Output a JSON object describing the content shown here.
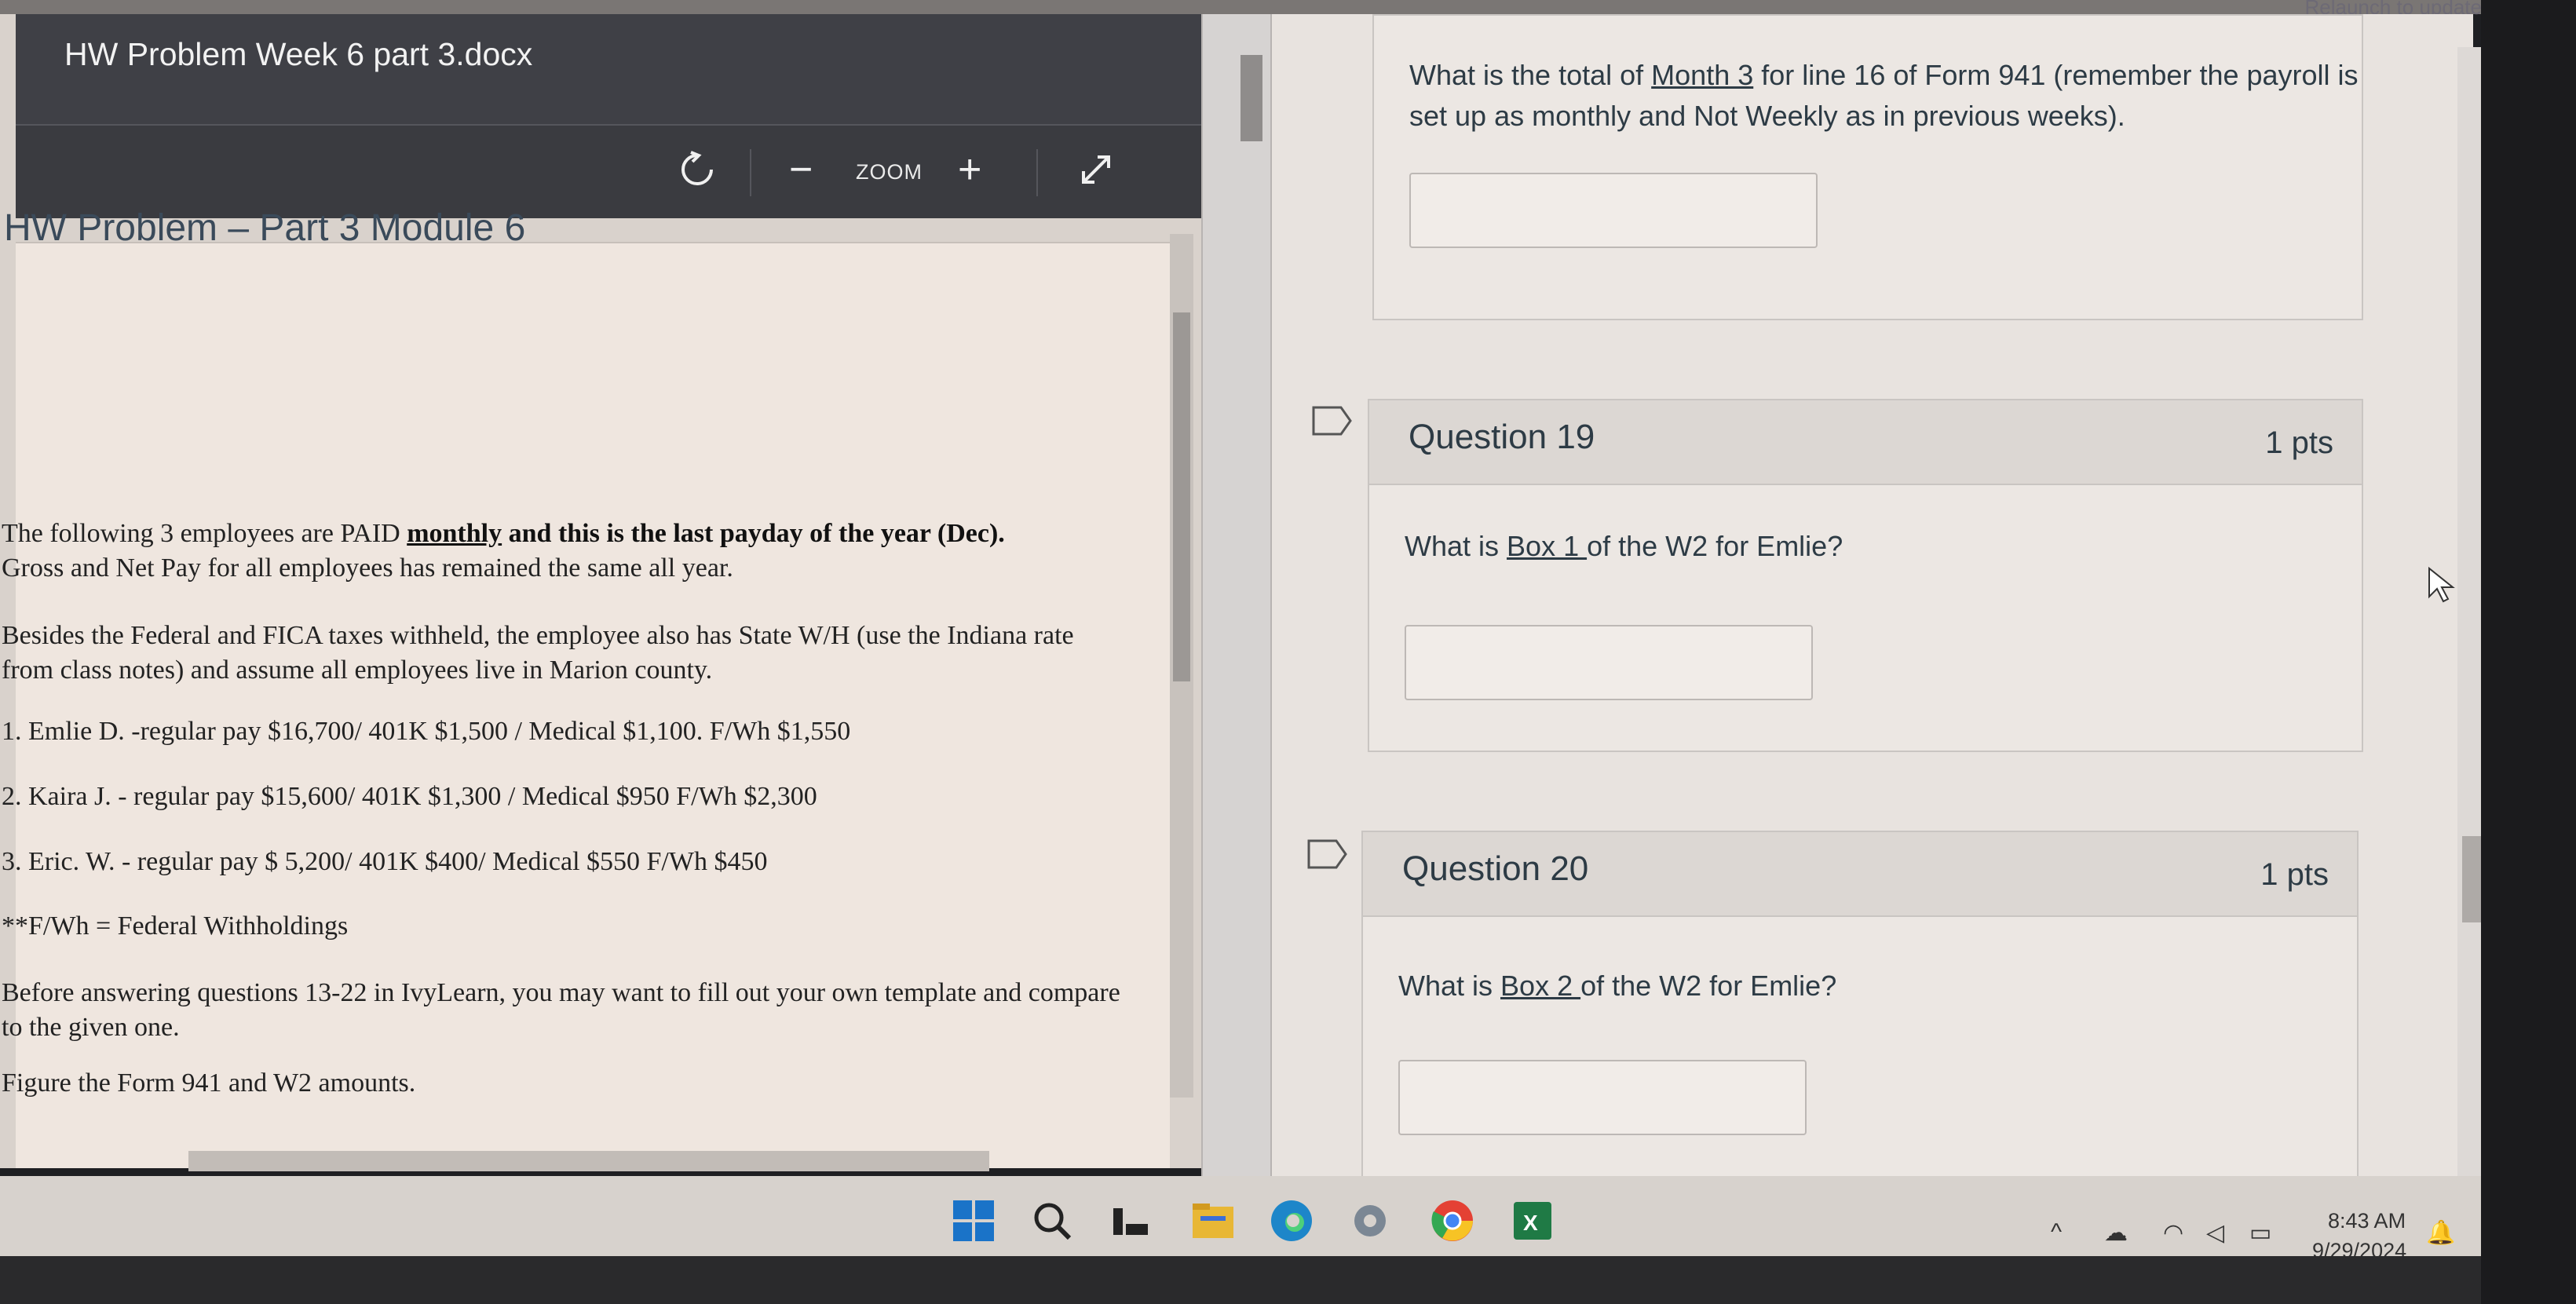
{
  "browser": {
    "relaunch_label": "Relaunch to update"
  },
  "document": {
    "title": "HW Problem Week 6 part 3.docx",
    "toolbar": {
      "zoom_label": "ZOOM",
      "zoom_out": "−",
      "zoom_in": "+"
    },
    "heading": "HW Problem – Part 3  Module 6",
    "paragraphs": {
      "p1a": "The following 3 employees are PAID ",
      "p1_bold": "monthly",
      "p1b": " and this is the ",
      "p1_bold2": "last payday of the year (Dec).",
      "p1c": "Gross and Net Pay for all employees has remained the same all year.",
      "p2": "Besides the Federal and FICA taxes withheld, the employee also has State W/H (use the Indiana rate from class notes) and assume all employees live in Marion county.",
      "emp1": "1.  Emlie D.  -regular pay $16,700/  401K  $1,500 / Medical $1,100.  F/Wh $1,550",
      "emp2": "2.  Kaira J.  -  regular pay  $15,600/  401K  $1,300 / Medical $950   F/Wh  $2,300",
      "emp3": "3.  Eric. W.  - regular pay  $ 5,200/  401K  $400/  Medical $550    F/Wh  $450",
      "note": "**F/Wh = Federal Withholdings",
      "p3": "Before answering questions 13-22 in IvyLearn, you may want to fill out your own template and compare to the given one.",
      "p4": "Figure the Form 941 and W2 amounts."
    }
  },
  "quiz": {
    "q18": {
      "text_a": "What is the total of ",
      "text_link": "Month 3",
      "text_b": " for line 16 of Form 941  (remember the payroll is set up as monthly and Not Weekly as in previous weeks)."
    },
    "q19": {
      "title": "Question 19",
      "pts": "1 pts",
      "text_a": "What is ",
      "text_link": "Box 1 ",
      "text_b": "of the W2 for Emlie?"
    },
    "q20": {
      "title": "Question 20",
      "pts": "1 pts",
      "text_a": "What is ",
      "text_link": "Box 2 ",
      "text_b": "of the W2 for Emlie?"
    }
  },
  "taskbar": {
    "time": "8:43 AM",
    "date": "9/29/2024",
    "apps": [
      "windows-start",
      "search",
      "task-view",
      "file-explorer",
      "edge",
      "settings",
      "chrome",
      "excel"
    ]
  }
}
